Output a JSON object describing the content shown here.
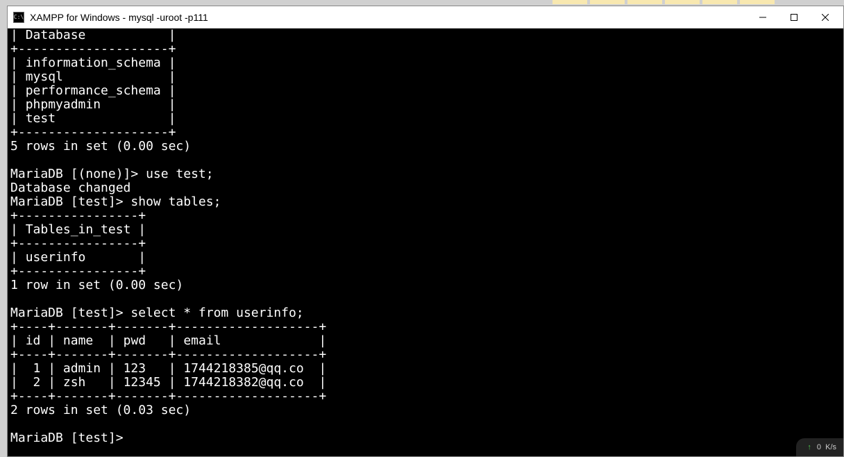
{
  "window": {
    "title": "XAMPP for Windows - mysql  -uroot -p111",
    "icon_label": "C:\\"
  },
  "databases_header": "Database",
  "databases": [
    "information_schema",
    "mysql",
    "performance_schema",
    "phpmyadmin",
    "test"
  ],
  "db_rows_msg": "5 rows in set (0.00 sec)",
  "prompt1": "MariaDB [(none)]> ",
  "cmd1": "use test;",
  "db_changed": "Database changed",
  "prompt2": "MariaDB [test]> ",
  "cmd2": "show tables;",
  "tables_header": "Tables_in_test",
  "tables": [
    "userinfo"
  ],
  "tables_rows_msg": "1 row in set (0.00 sec)",
  "prompt3": "MariaDB [test]> ",
  "cmd3": "select * from userinfo;",
  "userinfo_columns": [
    "id",
    "name",
    "pwd",
    "email"
  ],
  "userinfo_rows": [
    {
      "id": "1",
      "name": "admin",
      "pwd": "123",
      "email": "1744218385@qq.co"
    },
    {
      "id": "2",
      "name": "zsh",
      "pwd": "12345",
      "email": "1744218382@qq.co"
    }
  ],
  "userinfo_rows_msg": "2 rows in set (0.03 sec)",
  "prompt4": "MariaDB [test]> ",
  "status": {
    "up": "↑",
    "speed": "0  K/s"
  }
}
